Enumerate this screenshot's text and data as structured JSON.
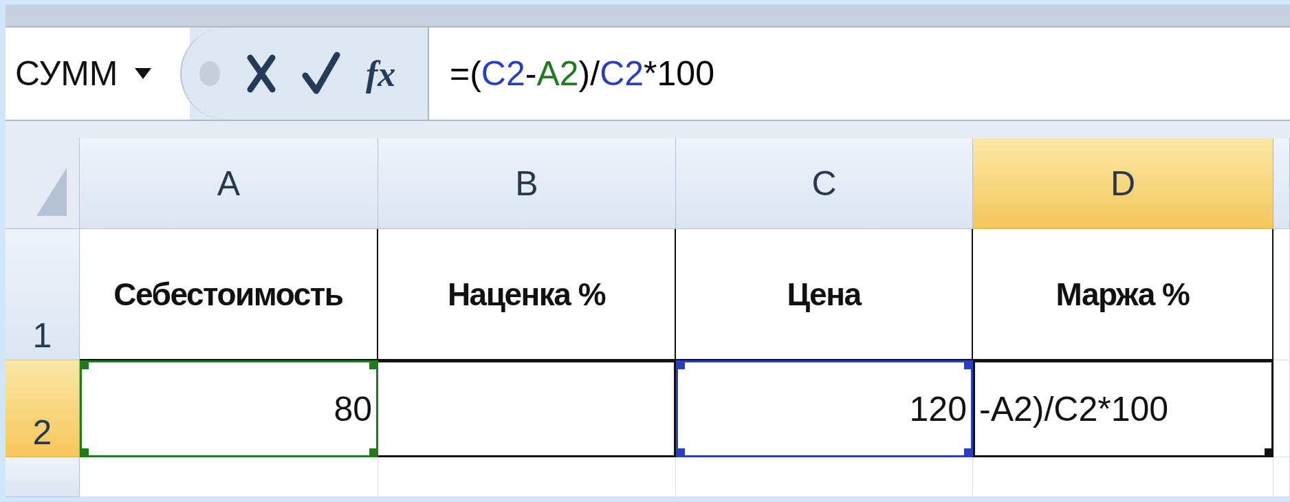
{
  "name_box": {
    "value": "СУММ"
  },
  "formula_bar": {
    "function_label": "fx",
    "tokens": [
      {
        "text": "=(",
        "color": "#000000"
      },
      {
        "text": "C2",
        "color": "#2a3fc0"
      },
      {
        "text": "-",
        "color": "#000000"
      },
      {
        "text": "A2",
        "color": "#1e7b1e"
      },
      {
        "text": ")/",
        "color": "#000000"
      },
      {
        "text": "C2",
        "color": "#2a3fc0"
      },
      {
        "text": "*100",
        "color": "#000000"
      }
    ]
  },
  "columns": [
    {
      "label": "A",
      "selected": false
    },
    {
      "label": "B",
      "selected": false
    },
    {
      "label": "C",
      "selected": false
    },
    {
      "label": "D",
      "selected": true
    }
  ],
  "rows": [
    {
      "label": "1",
      "selected": false,
      "cells": [
        {
          "kind": "heading",
          "text": "Себестоимость",
          "selected": false
        },
        {
          "kind": "heading",
          "text": "Наценка %",
          "selected": false
        },
        {
          "kind": "heading",
          "text": "Цена",
          "selected": false
        },
        {
          "kind": "heading",
          "text": "Маржа %",
          "selected": false
        }
      ]
    },
    {
      "label": "2",
      "selected": true,
      "cells": [
        {
          "kind": "number",
          "text": "80",
          "color": "#1e7b1e",
          "selected": false
        },
        {
          "kind": "number",
          "selected": false
        },
        {
          "kind": "number",
          "text": "120",
          "color": "#2a3fc0",
          "selected": false
        },
        {
          "kind": "formula",
          "text": "-A2)/C2*100",
          "selected": true
        }
      ]
    }
  ]
}
